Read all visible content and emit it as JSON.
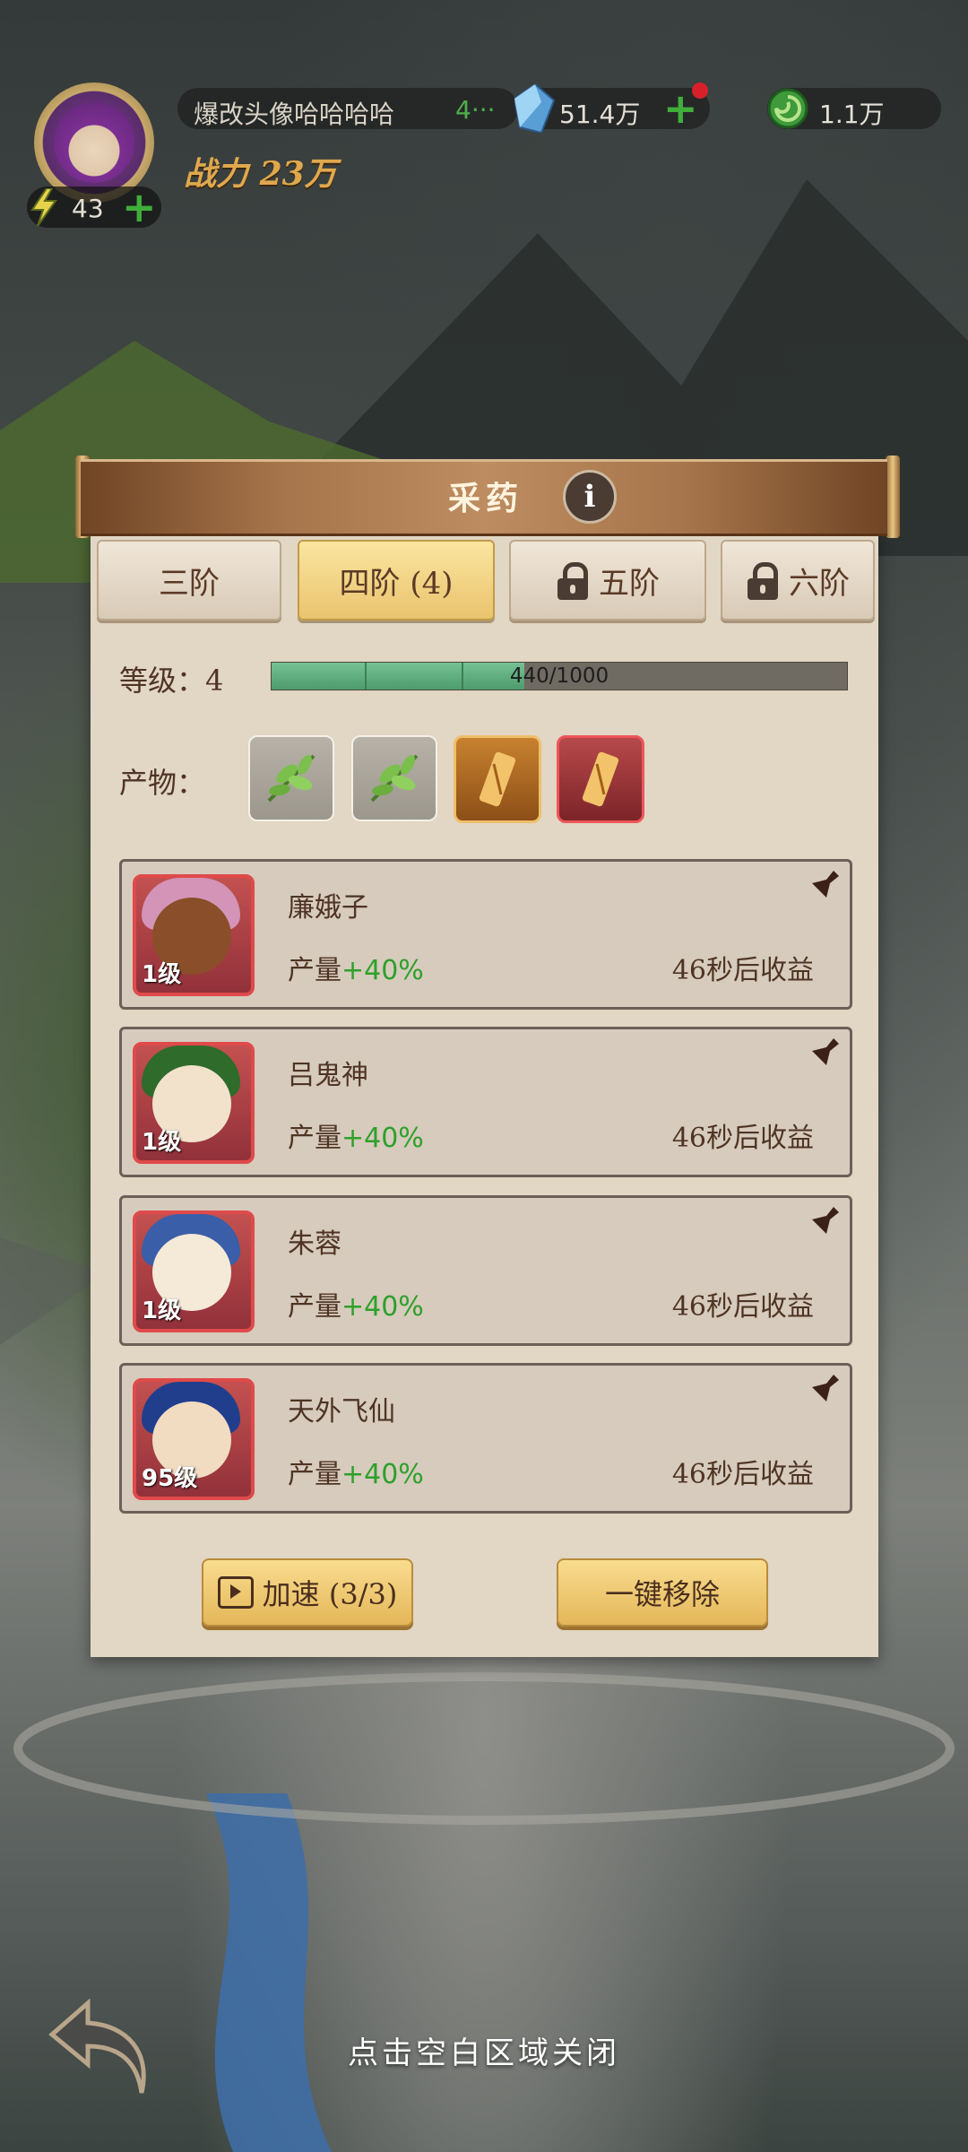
{
  "hud": {
    "player_name": "爆改头像哈哈哈哈",
    "player_name_suffix": "4···",
    "energy": "43",
    "power_label": "战力",
    "power_value": "23万",
    "gems": "51.4万",
    "jade": "1.1万"
  },
  "panel": {
    "title": "采药",
    "tabs": [
      {
        "label": "三阶",
        "locked": false,
        "active": false
      },
      {
        "label": "四阶 (4)",
        "locked": false,
        "active": true
      },
      {
        "label": "五阶",
        "locked": true,
        "active": false
      },
      {
        "label": "六阶",
        "locked": true,
        "active": false
      }
    ],
    "level_label": "等级：",
    "level_value": "4",
    "progress_text": "440/1000",
    "progress_fraction": 0.44,
    "products_label": "产物：",
    "products": [
      {
        "icon": "herb-leaf-icon",
        "rarity": "common"
      },
      {
        "icon": "herb-leaf-icon",
        "rarity": "common"
      },
      {
        "icon": "scroll-icon",
        "rarity": "orange"
      },
      {
        "icon": "scroll-icon",
        "rarity": "red"
      }
    ],
    "workers": [
      {
        "name": "廉娥子",
        "level": "1级",
        "yield_label": "产量",
        "yield_value": "+40%",
        "timer": "46秒后收益"
      },
      {
        "name": "吕鬼神",
        "level": "1级",
        "yield_label": "产量",
        "yield_value": "+40%",
        "timer": "46秒后收益"
      },
      {
        "name": "朱蓉",
        "level": "1级",
        "yield_label": "产量",
        "yield_value": "+40%",
        "timer": "46秒后收益"
      },
      {
        "name": "天外飞仙",
        "level": "95级",
        "yield_label": "产量",
        "yield_value": "+40%",
        "timer": "46秒后收益"
      }
    ],
    "speedup_label": "加速 (3/3)",
    "remove_all_label": "一键移除"
  },
  "close_hint": "点击空白区域关闭",
  "colors": {
    "accent_green": "#2ea02a",
    "header_brown": "#a7754b",
    "button_gold": "#e9c46e"
  }
}
